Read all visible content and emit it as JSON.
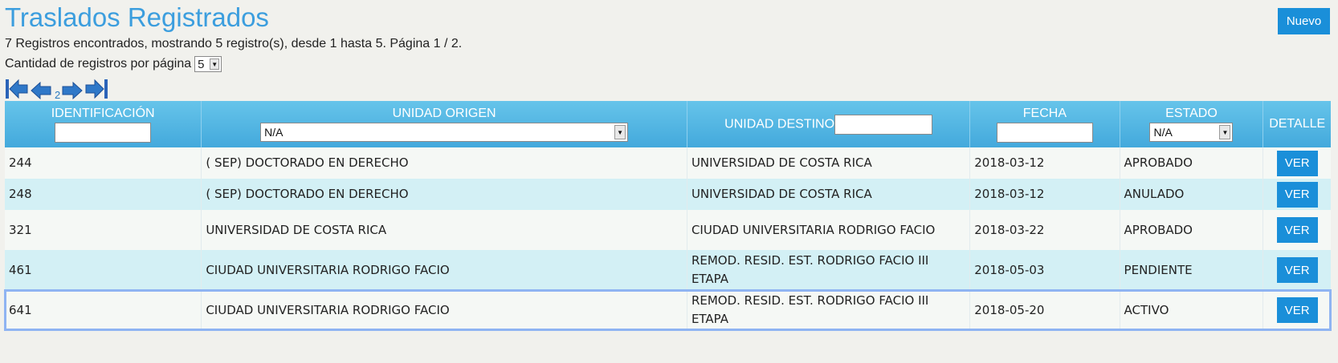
{
  "page": {
    "title": "Traslados Registrados",
    "new_button": "Nuevo",
    "summary": "7 Registros encontrados, mostrando 5 registro(s), desde 1 hasta 5. Página 1 / 2.",
    "per_page_label": "Cantidad de registros por página",
    "per_page_value": "5"
  },
  "pager": {
    "page_number": "2",
    "icons": [
      "first-page-icon",
      "previous-page-icon",
      "next-page-icon",
      "last-page-icon"
    ]
  },
  "table": {
    "headers": {
      "id": "IDENTIFICACIÓN",
      "origin": "UNIDAD ORIGEN",
      "destination": "UNIDAD DESTINO",
      "date": "FECHA",
      "status": "ESTADO",
      "detail": "DETALLE"
    },
    "filters": {
      "origin_value": "N/A",
      "status_value": "N/A"
    },
    "rows": [
      {
        "id": "244",
        "origin": "( SEP) DOCTORADO EN DERECHO",
        "destination": "UNIVERSIDAD DE COSTA RICA",
        "date": "2018-03-12",
        "status": "APROBADO",
        "action": "VER"
      },
      {
        "id": "248",
        "origin": "( SEP) DOCTORADO EN DERECHO",
        "destination": "UNIVERSIDAD DE COSTA RICA",
        "date": "2018-03-12",
        "status": "ANULADO",
        "action": "VER"
      },
      {
        "id": "321",
        "origin": "UNIVERSIDAD DE COSTA RICA",
        "destination": "CIUDAD UNIVERSITARIA RODRIGO FACIO",
        "date": "2018-03-22",
        "status": "APROBADO",
        "action": "VER"
      },
      {
        "id": "461",
        "origin": "CIUDAD UNIVERSITARIA RODRIGO FACIO",
        "destination": "REMOD. RESID. EST. RODRIGO FACIO III ETAPA",
        "date": "2018-05-03",
        "status": "PENDIENTE",
        "action": "VER"
      },
      {
        "id": "641",
        "origin": "CIUDAD UNIVERSITARIA RODRIGO FACIO",
        "destination": "REMOD. RESID. EST. RODRIGO FACIO III ETAPA",
        "date": "2018-05-20",
        "status": "ACTIVO",
        "action": "VER"
      }
    ]
  },
  "colors": {
    "accent": "#3c9ede",
    "button": "#1a8fd9",
    "header": "#4db3e0",
    "row_alt": "#d3f0f5"
  }
}
